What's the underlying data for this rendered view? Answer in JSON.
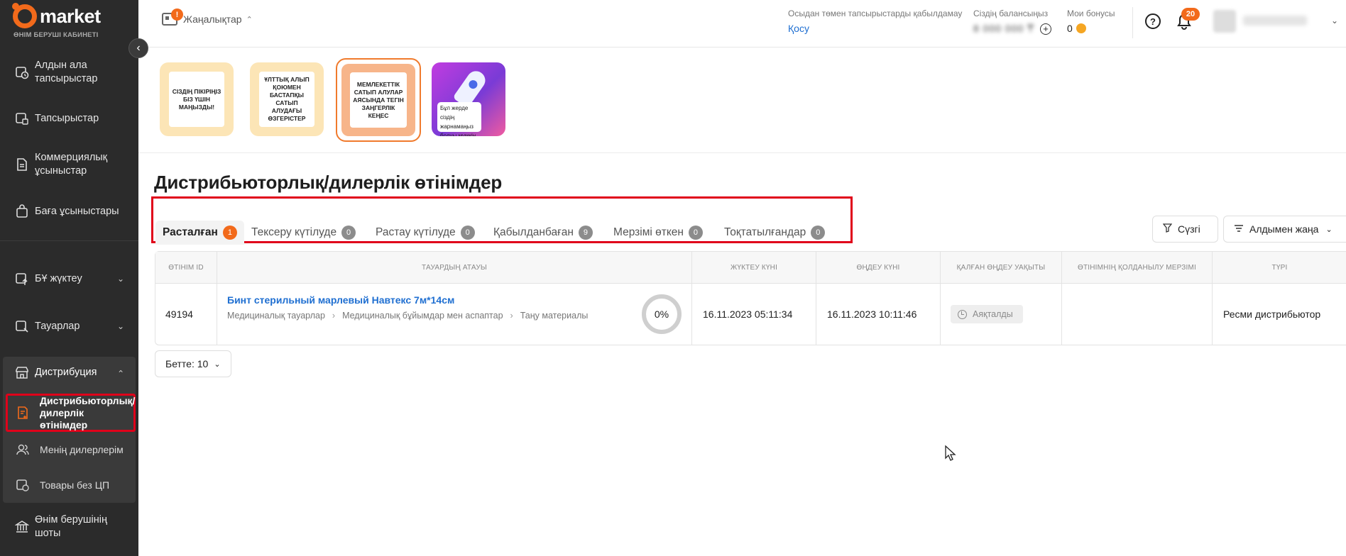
{
  "brand": {
    "name": "market",
    "subtitle": "ӨНІМ БЕРУШІ КАБИНЕТІ"
  },
  "sidebar": {
    "items": [
      {
        "label": "Алдын ала тапсырыстар",
        "icon": "calendar-clock-icon"
      },
      {
        "label": "Тапсырыстар",
        "icon": "box-icon"
      },
      {
        "label": "Коммерциялық ұсыныстар",
        "icon": "document-icon"
      },
      {
        "label": "Баға ұсыныстары",
        "icon": "bag-icon"
      },
      {
        "label": "БҰ жүктеу",
        "icon": "upload-icon"
      },
      {
        "label": "Тауарлар",
        "icon": "goods-icon"
      },
      {
        "label": "Дистрибуция",
        "icon": "store-icon"
      },
      {
        "label": "Өнім берушінің шоты",
        "icon": "bank-icon"
      }
    ],
    "distribution_sub": [
      {
        "label": "Дистрибьюторлық/ дилерлік өтінімдер",
        "icon": "application-icon"
      },
      {
        "label": "Менің дилерлерім",
        "icon": "users-icon"
      },
      {
        "label": "Товары без ЦП",
        "icon": "price-tag-icon"
      }
    ]
  },
  "header": {
    "news_label": "Жаңалықтар",
    "news_badge": "!",
    "orders_label": "Осыдан төмен тапсырыстарды қабылдамау",
    "orders_link": "Қосу",
    "balance_label": "Сіздің балансыңыз",
    "balance_value": "8 000 000 ₸",
    "bonus_label": "Мои бонусы",
    "bonus_value": "0",
    "notifications_count": "20",
    "help_icon": "?"
  },
  "banners": [
    {
      "text": "СІЗДІҢ ПІКІРІҢІЗ БІЗ ҮШІН МАҢЫЗДЫ!"
    },
    {
      "text": "ҰЛТТЫҚ АЛЫП ҚОЮМЕН БАСТАПҚЫ САТЫП АЛУДАҒЫ ӨЗГЕРІСТЕР"
    },
    {
      "text": "МЕМЛЕКЕТТІК САТЫП АЛУЛАР АЯСЫНДА ТЕГІН ЗАҢГЕРЛІК КЕҢЕС"
    },
    {
      "text": "Бұл жерде сіздің жарнамаңыз болуы мүмкін"
    }
  ],
  "page": {
    "title": "Дистрибьюторлық/дилерлік өтінімдер",
    "tabs": [
      {
        "label": "Расталған",
        "count": "1"
      },
      {
        "label": "Тексеру күтілуде",
        "count": "0"
      },
      {
        "label": "Растау күтілуде",
        "count": "0"
      },
      {
        "label": "Қабылданбаған",
        "count": "9"
      },
      {
        "label": "Мерзімі өткен",
        "count": "0"
      },
      {
        "label": "Тоқтатылғандар",
        "count": "0"
      }
    ],
    "filter_label": "Сүзгі",
    "sort_label": "Алдымен жаңа",
    "per_page_label": "Бетте: 10"
  },
  "table": {
    "columns": [
      "Өтінім ID",
      "Тауардың атауы",
      "Жүктеу күні",
      "Өңдеу күні",
      "Қалған өңдеу уақыты",
      "Өтінімнің қолданылу мерзімі",
      "Түрі"
    ],
    "rows": [
      {
        "id": "49194",
        "product": "Бинт стерильный марлевый Навтекс 7м*14см",
        "cat1": "Медициналық тауарлар",
        "cat2": "Медициналық бұйымдар мен аспаптар",
        "cat3": "Таңу материалы",
        "progress": "0%",
        "upload_date": "16.11.2023 05:11:34",
        "process_date": "16.11.2023 10:11:46",
        "remaining": "Аяқталды",
        "validity": "",
        "type": "Ресми дистрибьютор"
      }
    ]
  },
  "colors": {
    "accent": "#f26a1b",
    "link": "#1f6fd1",
    "highlight": "#e0001a",
    "sidebar": "#2b2b2b"
  }
}
